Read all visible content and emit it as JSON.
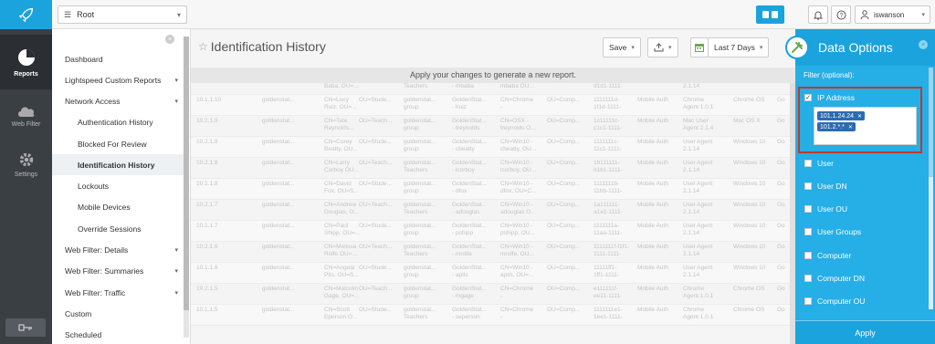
{
  "rail": {
    "items": [
      {
        "label": "Reports",
        "icon": "pie-chart-icon"
      },
      {
        "label": "Web Filter",
        "icon": "cloud-icon"
      },
      {
        "label": "Settings",
        "icon": "gear-icon"
      }
    ]
  },
  "topbar": {
    "root_label": "Root",
    "username": "iswanson"
  },
  "sidenav": {
    "items": [
      {
        "label": "Dashboard"
      },
      {
        "label": "Lightspeed Custom Reports"
      },
      {
        "label": "Network Access"
      },
      {
        "label": "Authentication History"
      },
      {
        "label": "Blocked For Review"
      },
      {
        "label": "Identification History"
      },
      {
        "label": "Lockouts"
      },
      {
        "label": "Mobile Devices"
      },
      {
        "label": "Override Sessions"
      },
      {
        "label": "Web Filter: Details"
      },
      {
        "label": "Web Filter: Summaries"
      },
      {
        "label": "Web Filter: Traffic"
      },
      {
        "label": "Custom"
      },
      {
        "label": "Scheduled"
      }
    ]
  },
  "main": {
    "title": "Identification History",
    "save_label": "Save",
    "range_label": "Last 7 Days",
    "notice": "Apply your changes to generate a new report.",
    "rows": [
      [
        "10.1.2.19",
        "goldenstat...",
        "CN=Babe\nBaba, OU=...",
        "OU=Stude...",
        "goldenstat...\nTeachers",
        "GoldenStat...\n- mbaba",
        "CN=Win8 -\nmbaba OU...",
        "OU=Comp...",
        "1111111-\nd1d1-1111-",
        "Mobile Auth",
        "User Agent\n2.1.14",
        "Windows 10",
        "Go"
      ],
      [
        "10.1.1.10",
        "goldenstat...",
        "CN=Lucy\nRuiz, OU=...",
        "OU=Stude...",
        "goldenstat...\ngroup",
        "GoldenStat...\n- lruiz",
        "CN=Chrome\n-",
        "OU=Comp...",
        "1111111d-\n1f1d-1111-",
        "Mobile Auth",
        "Chrome\nAgent 1.0.1",
        "Chrome OS",
        "Go"
      ],
      [
        "10.2.1.9",
        "goldenstat...",
        "CN=Tate\nReynolds...",
        "OU=Teach...",
        "goldenstat...\ngroup",
        "GoldenStat...\n- treynolds",
        "CN=OSX -\ntreynolds O...",
        "OU=Comp...",
        "1c11111c-\nc1c1-1111-",
        "Mobile Auth",
        "Mac User\nAgent 2.1.4",
        "Mac OS X",
        "Go"
      ],
      [
        "10.2.1.9",
        "goldenstat...",
        "CN=Corey\nBeatty, OU...",
        "OU=Stude...",
        "goldenstat...\ngroup",
        "GoldenStat...\n- cbeatty",
        "CN=Win10 -\ncbeatty, OU...",
        "OU=Comp...",
        "1111111c-\n11c1-1111-",
        "Mobile Auth",
        "User Agent\n2.1.14",
        "Windows 10",
        "Go"
      ],
      [
        "10.2.1.8",
        "goldenstat...",
        "CN=Larry\nCorboy OU...",
        "OU=Teach...",
        "goldenstat...\nTeachers",
        "GoldenStat...\n- lcorboy",
        "CN=Win10 -\nlcorboy, OU...",
        "OU=Comp...",
        "1b111111-\nb1b1-1111-",
        "Mobile Auth",
        "User Agent\n2.1.14",
        "Windows 10",
        "Go"
      ],
      [
        "10.1.1.8",
        "goldenstat...",
        "CN=David\nFox, OU=S...",
        "OU=Stude...",
        "goldenstat...\ngroup",
        "GoldenStat...\n- dfox",
        "CN=Win10 -\ndfox, OU=C...",
        "OU=Comp...",
        "1111111b-\n11bb-1111-",
        "Mobile Auth",
        "User Agent\n2.1.14",
        "Windows 10",
        "Go"
      ],
      [
        "10.2.1.7",
        "goldenstat...",
        "CN=Andrew\nDouglas, O...",
        "OU=Teach...",
        "goldenstat...\nTeachers",
        "GoldenStat...\n- adouglas",
        "CN=Win10 -\nadouglas O...",
        "OU=Comp...",
        "1a111111-\na1a1-1111-",
        "Mobile Auth",
        "User Agent\n2.1.14",
        "Windows 10",
        "Go"
      ],
      [
        "10.1.1.7",
        "goldenstat...",
        "CN=Paul\nShipp, OU=...",
        "OU=Stude...",
        "goldenstat...\ngroup",
        "GoldenStat...\n- pshipp",
        "CN=Win10 -\npshipp, OU...",
        "OU=Comp...",
        "1111111a-\n11aa-1111-",
        "Mobile Auth",
        "User Agent\n2.1.14",
        "Windows 10",
        "Go"
      ],
      [
        "10.2.1.6",
        "goldenstat...",
        "CN=Melissa\nRolfe OU=...",
        "OU=Teach...",
        "goldenstat...\nTeachers",
        "GoldenStat...\n- mrolfe",
        "CN=Win10 -\nmrolfe, OU...",
        "OU=Comp...",
        "1111111f-f1f1-\n1111-1111-",
        "Mobile Auth",
        "User Agent\n2.1.14",
        "Windows 10",
        "Go"
      ],
      [
        "10.1.1.6",
        "goldenstat...",
        "CN=Angela\nPits, OU=S...",
        "OU=Stude...",
        "goldenstat...\ngroup",
        "GoldenStat...\n- apits",
        "CN=Win10 -\napits, OU=...",
        "OU=Comp...",
        "11111ff1-\n1ff1-1111-",
        "Mobile Auth",
        "User Agent\n2.1.14",
        "Windows 10",
        "Go"
      ],
      [
        "10.2.1.5",
        "goldenstat...",
        "CN=Malcolm\nGage, OU=...",
        "OU=Teach...",
        "goldenstat...\ngroup",
        "GoldenStat...\n- mgage",
        "CN=Chrome\n-",
        "OU=Comp...",
        "e111111f-\nee11-1111-",
        "Mobile Auth",
        "Chrome\nAgent 1.0.1",
        "Chrome OS",
        "Go"
      ],
      [
        "10.1.1.5",
        "goldenstat...",
        "CN=Scott\nEperson O...",
        "OU=Stude...",
        "goldenstat...\nTeachers",
        "GoldenStat...\n- seperson",
        "CN=Chrome\n-",
        "OU=Comp...",
        "1111111e1-\n1ee1-1111-",
        "Mobile Auth",
        "Chrome\nAgent 1.0.1",
        "Chrome OS",
        "Go"
      ]
    ]
  },
  "data_options": {
    "title": "Data Options",
    "filter_label": "Filter (optional):",
    "options": [
      {
        "label": "IP Address",
        "checked": true
      },
      {
        "label": "User",
        "checked": false
      },
      {
        "label": "User DN",
        "checked": false
      },
      {
        "label": "User OU",
        "checked": false
      },
      {
        "label": "User Groups",
        "checked": false
      },
      {
        "label": "Computer",
        "checked": false
      },
      {
        "label": "Computer DN",
        "checked": false
      },
      {
        "label": "Computer OU",
        "checked": false
      }
    ],
    "ip_tags": [
      "101.1.24.24",
      "101.2.*.*"
    ],
    "apply_label": "Apply"
  },
  "colors": {
    "accent": "#1aa3dc",
    "rail": "#3a3f44",
    "highlight": "#c0392b"
  }
}
